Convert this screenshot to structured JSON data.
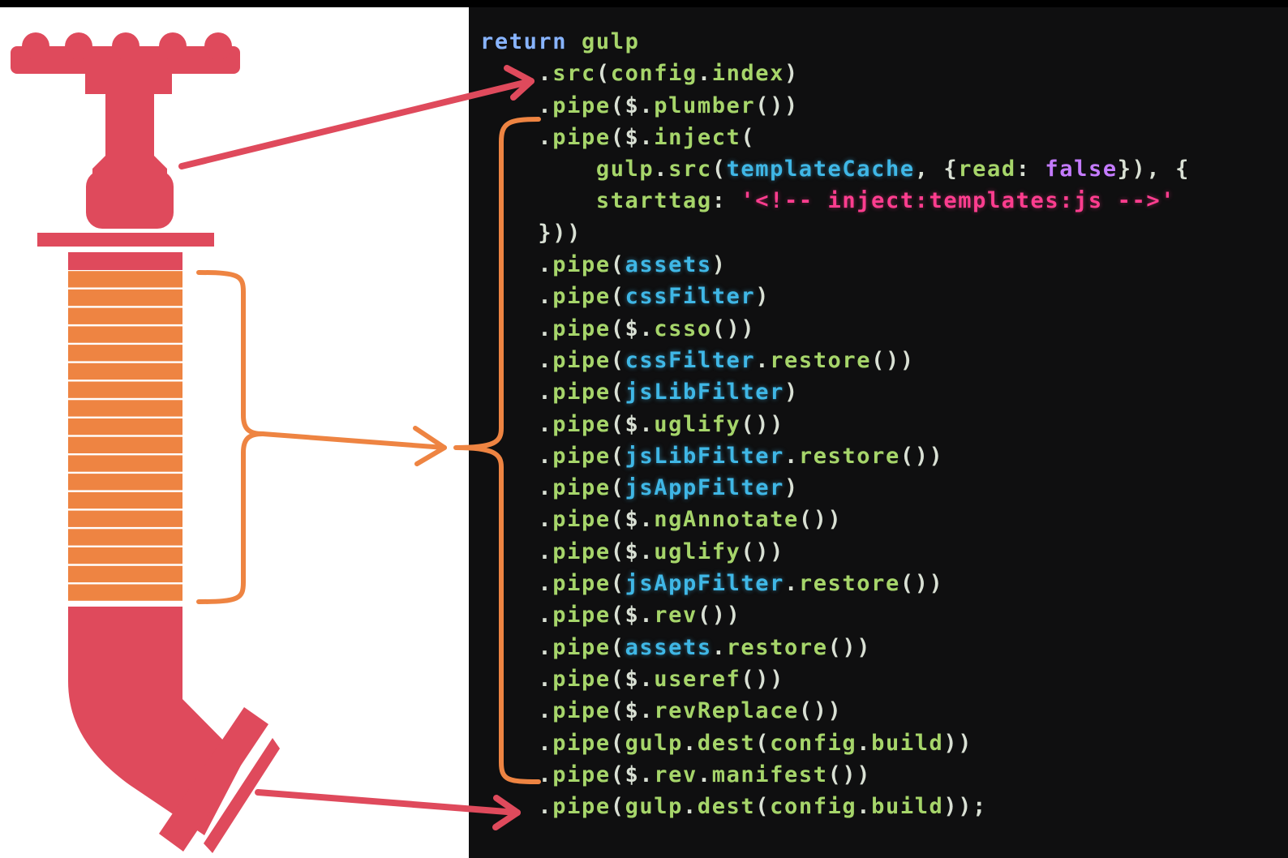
{
  "colors": {
    "valve": "#df4a5c",
    "coil": "#ee8442",
    "bracket": "#ee8442",
    "background_left": "#ffffff",
    "background_right": "#0f0f10",
    "code_default": "#d9e0d4",
    "code_keyword": "#88b4ff",
    "code_name": "#a6d56a",
    "code_var": "#3fb7e6",
    "code_string": "#ff3d8f",
    "code_bool": "#c47bff"
  },
  "code_lines": [
    [
      {
        "t": "return ",
        "c": "keyword"
      },
      {
        "t": "gulp",
        "c": "name"
      }
    ],
    [
      {
        "t": "    .",
        "c": "default"
      },
      {
        "t": "src",
        "c": "name"
      },
      {
        "t": "(",
        "c": "default"
      },
      {
        "t": "config",
        "c": "name"
      },
      {
        "t": ".",
        "c": "default"
      },
      {
        "t": "index",
        "c": "name"
      },
      {
        "t": ")",
        "c": "default"
      }
    ],
    [
      {
        "t": "    .",
        "c": "default"
      },
      {
        "t": "pipe",
        "c": "name"
      },
      {
        "t": "($.",
        "c": "default"
      },
      {
        "t": "plumber",
        "c": "name"
      },
      {
        "t": "())",
        "c": "default"
      }
    ],
    [
      {
        "t": "    .",
        "c": "default"
      },
      {
        "t": "pipe",
        "c": "name"
      },
      {
        "t": "($.",
        "c": "default"
      },
      {
        "t": "inject",
        "c": "name"
      },
      {
        "t": "(",
        "c": "default"
      }
    ],
    [
      {
        "t": "        ",
        "c": "default"
      },
      {
        "t": "gulp",
        "c": "name"
      },
      {
        "t": ".",
        "c": "default"
      },
      {
        "t": "src",
        "c": "name"
      },
      {
        "t": "(",
        "c": "default"
      },
      {
        "t": "templateCache",
        "c": "var"
      },
      {
        "t": ", {",
        "c": "default"
      },
      {
        "t": "read",
        "c": "name"
      },
      {
        "t": ": ",
        "c": "default"
      },
      {
        "t": "false",
        "c": "bool"
      },
      {
        "t": "}), {",
        "c": "default"
      }
    ],
    [
      {
        "t": "        ",
        "c": "default"
      },
      {
        "t": "starttag",
        "c": "name"
      },
      {
        "t": ": ",
        "c": "default"
      },
      {
        "t": "'<!-- inject:templates:js -->'",
        "c": "string"
      }
    ],
    [
      {
        "t": "    }))",
        "c": "default"
      }
    ],
    [
      {
        "t": "    .",
        "c": "default"
      },
      {
        "t": "pipe",
        "c": "name"
      },
      {
        "t": "(",
        "c": "default"
      },
      {
        "t": "assets",
        "c": "var"
      },
      {
        "t": ")",
        "c": "default"
      }
    ],
    [
      {
        "t": "    .",
        "c": "default"
      },
      {
        "t": "pipe",
        "c": "name"
      },
      {
        "t": "(",
        "c": "default"
      },
      {
        "t": "cssFilter",
        "c": "var"
      },
      {
        "t": ")",
        "c": "default"
      }
    ],
    [
      {
        "t": "    .",
        "c": "default"
      },
      {
        "t": "pipe",
        "c": "name"
      },
      {
        "t": "($.",
        "c": "default"
      },
      {
        "t": "csso",
        "c": "name"
      },
      {
        "t": "())",
        "c": "default"
      }
    ],
    [
      {
        "t": "    .",
        "c": "default"
      },
      {
        "t": "pipe",
        "c": "name"
      },
      {
        "t": "(",
        "c": "default"
      },
      {
        "t": "cssFilter",
        "c": "var"
      },
      {
        "t": ".",
        "c": "default"
      },
      {
        "t": "restore",
        "c": "name"
      },
      {
        "t": "())",
        "c": "default"
      }
    ],
    [
      {
        "t": "    .",
        "c": "default"
      },
      {
        "t": "pipe",
        "c": "name"
      },
      {
        "t": "(",
        "c": "default"
      },
      {
        "t": "jsLibFilter",
        "c": "var"
      },
      {
        "t": ")",
        "c": "default"
      }
    ],
    [
      {
        "t": "    .",
        "c": "default"
      },
      {
        "t": "pipe",
        "c": "name"
      },
      {
        "t": "($.",
        "c": "default"
      },
      {
        "t": "uglify",
        "c": "name"
      },
      {
        "t": "())",
        "c": "default"
      }
    ],
    [
      {
        "t": "    .",
        "c": "default"
      },
      {
        "t": "pipe",
        "c": "name"
      },
      {
        "t": "(",
        "c": "default"
      },
      {
        "t": "jsLibFilter",
        "c": "var"
      },
      {
        "t": ".",
        "c": "default"
      },
      {
        "t": "restore",
        "c": "name"
      },
      {
        "t": "())",
        "c": "default"
      }
    ],
    [
      {
        "t": "    .",
        "c": "default"
      },
      {
        "t": "pipe",
        "c": "name"
      },
      {
        "t": "(",
        "c": "default"
      },
      {
        "t": "jsAppFilter",
        "c": "var"
      },
      {
        "t": ")",
        "c": "default"
      }
    ],
    [
      {
        "t": "    .",
        "c": "default"
      },
      {
        "t": "pipe",
        "c": "name"
      },
      {
        "t": "($.",
        "c": "default"
      },
      {
        "t": "ngAnnotate",
        "c": "name"
      },
      {
        "t": "())",
        "c": "default"
      }
    ],
    [
      {
        "t": "    .",
        "c": "default"
      },
      {
        "t": "pipe",
        "c": "name"
      },
      {
        "t": "($.",
        "c": "default"
      },
      {
        "t": "uglify",
        "c": "name"
      },
      {
        "t": "())",
        "c": "default"
      }
    ],
    [
      {
        "t": "    .",
        "c": "default"
      },
      {
        "t": "pipe",
        "c": "name"
      },
      {
        "t": "(",
        "c": "default"
      },
      {
        "t": "jsAppFilter",
        "c": "var"
      },
      {
        "t": ".",
        "c": "default"
      },
      {
        "t": "restore",
        "c": "name"
      },
      {
        "t": "())",
        "c": "default"
      }
    ],
    [
      {
        "t": "    .",
        "c": "default"
      },
      {
        "t": "pipe",
        "c": "name"
      },
      {
        "t": "($.",
        "c": "default"
      },
      {
        "t": "rev",
        "c": "name"
      },
      {
        "t": "())",
        "c": "default"
      }
    ],
    [
      {
        "t": "    .",
        "c": "default"
      },
      {
        "t": "pipe",
        "c": "name"
      },
      {
        "t": "(",
        "c": "default"
      },
      {
        "t": "assets",
        "c": "var"
      },
      {
        "t": ".",
        "c": "default"
      },
      {
        "t": "restore",
        "c": "name"
      },
      {
        "t": "())",
        "c": "default"
      }
    ],
    [
      {
        "t": "    .",
        "c": "default"
      },
      {
        "t": "pipe",
        "c": "name"
      },
      {
        "t": "($.",
        "c": "default"
      },
      {
        "t": "useref",
        "c": "name"
      },
      {
        "t": "())",
        "c": "default"
      }
    ],
    [
      {
        "t": "    .",
        "c": "default"
      },
      {
        "t": "pipe",
        "c": "name"
      },
      {
        "t": "($.",
        "c": "default"
      },
      {
        "t": "revReplace",
        "c": "name"
      },
      {
        "t": "())",
        "c": "default"
      }
    ],
    [
      {
        "t": "    .",
        "c": "default"
      },
      {
        "t": "pipe",
        "c": "name"
      },
      {
        "t": "(",
        "c": "default"
      },
      {
        "t": "gulp",
        "c": "name"
      },
      {
        "t": ".",
        "c": "default"
      },
      {
        "t": "dest",
        "c": "name"
      },
      {
        "t": "(",
        "c": "default"
      },
      {
        "t": "config",
        "c": "name"
      },
      {
        "t": ".",
        "c": "default"
      },
      {
        "t": "build",
        "c": "name"
      },
      {
        "t": "))",
        "c": "default"
      }
    ],
    [
      {
        "t": "    .",
        "c": "default"
      },
      {
        "t": "pipe",
        "c": "name"
      },
      {
        "t": "($.",
        "c": "default"
      },
      {
        "t": "rev",
        "c": "name"
      },
      {
        "t": ".",
        "c": "default"
      },
      {
        "t": "manifest",
        "c": "name"
      },
      {
        "t": "())",
        "c": "default"
      }
    ],
    [
      {
        "t": "    .",
        "c": "default"
      },
      {
        "t": "pipe",
        "c": "name"
      },
      {
        "t": "(",
        "c": "default"
      },
      {
        "t": "gulp",
        "c": "name"
      },
      {
        "t": ".",
        "c": "default"
      },
      {
        "t": "dest",
        "c": "name"
      },
      {
        "t": "(",
        "c": "default"
      },
      {
        "t": "config",
        "c": "name"
      },
      {
        "t": ".",
        "c": "default"
      },
      {
        "t": "build",
        "c": "name"
      },
      {
        "t": "));",
        "c": "default"
      }
    ]
  ],
  "coil_segments": 18
}
